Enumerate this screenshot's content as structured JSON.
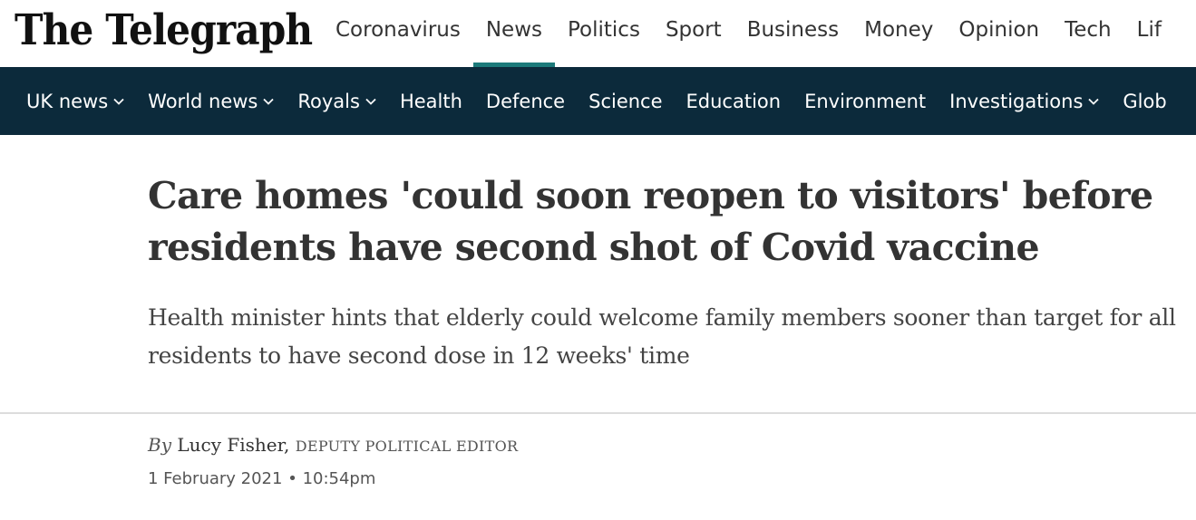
{
  "brand": {
    "logo_text": "The Telegraph"
  },
  "top_nav": [
    {
      "label": "Coronavirus",
      "active": false
    },
    {
      "label": "News",
      "active": true
    },
    {
      "label": "Politics",
      "active": false
    },
    {
      "label": "Sport",
      "active": false
    },
    {
      "label": "Business",
      "active": false
    },
    {
      "label": "Money",
      "active": false
    },
    {
      "label": "Opinion",
      "active": false
    },
    {
      "label": "Tech",
      "active": false
    },
    {
      "label": "Lif",
      "active": false
    }
  ],
  "section_nav": [
    {
      "label": "UK news",
      "has_dropdown": true
    },
    {
      "label": "World news",
      "has_dropdown": true
    },
    {
      "label": "Royals",
      "has_dropdown": true
    },
    {
      "label": "Health",
      "has_dropdown": false
    },
    {
      "label": "Defence",
      "has_dropdown": false
    },
    {
      "label": "Science",
      "has_dropdown": false
    },
    {
      "label": "Education",
      "has_dropdown": false
    },
    {
      "label": "Environment",
      "has_dropdown": false
    },
    {
      "label": "Investigations",
      "has_dropdown": true
    },
    {
      "label": "Glob",
      "has_dropdown": false
    }
  ],
  "article": {
    "headline": "Care homes 'could soon reopen to visitors' before residents have second shot of Covid vaccine",
    "standfirst": "Health minister hints that elderly could welcome family members sooner than target for all residents to have second dose in 12 weeks' time",
    "byline": {
      "prefix": "By",
      "author": "Lucy Fisher,",
      "role": "DEPUTY POLITICAL EDITOR"
    },
    "date": "1 February 2021",
    "separator": "•",
    "time": "10:54pm"
  },
  "colors": {
    "section_bar": "#0c2a3b",
    "active_underline": "#1c7a7a",
    "text": "#333333"
  }
}
